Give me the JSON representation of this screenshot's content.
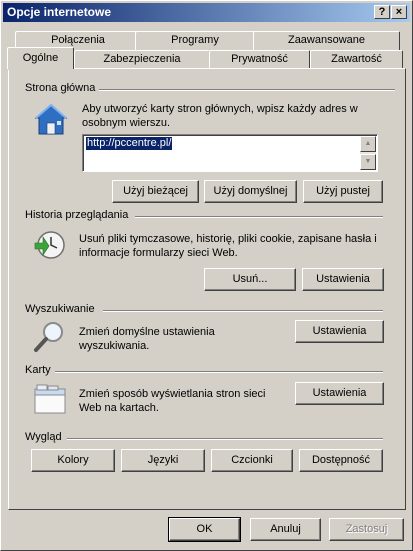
{
  "window": {
    "title": "Opcje internetowe",
    "help_label": "?",
    "close_label": "×"
  },
  "tabs": {
    "row_top": [
      "Połączenia",
      "Programy",
      "Zaawansowane"
    ],
    "row_bottom": [
      "Ogólne",
      "Zabezpieczenia",
      "Prywatność",
      "Zawartość"
    ],
    "active": "Ogólne"
  },
  "home": {
    "label": "Strona główna",
    "description": "Aby utworzyć karty stron głównych, wpisz każdy adres w osobnym wierszu.",
    "url_value": "http://pccentre.pl/",
    "btn_current": "Użyj bieżącej",
    "btn_default": "Użyj domyślnej",
    "btn_blank": "Użyj pustej"
  },
  "history": {
    "label": "Historia przeglądania",
    "description": "Usuń pliki tymczasowe, historię, pliki cookie, zapisane hasła i informacje formularzy sieci Web.",
    "btn_delete": "Usuń...",
    "btn_settings": "Ustawienia"
  },
  "search": {
    "label": "Wyszukiwanie",
    "description": "Zmień domyślne ustawienia wyszukiwania.",
    "btn_settings": "Ustawienia"
  },
  "tabs_section": {
    "label": "Karty",
    "description": "Zmień sposób wyświetlania stron sieci Web na kartach.",
    "btn_settings": "Ustawienia"
  },
  "appearance": {
    "label": "Wygląd",
    "btn_colors": "Kolory",
    "btn_languages": "Języki",
    "btn_fonts": "Czcionki",
    "btn_accessibility": "Dostępność"
  },
  "footer": {
    "ok": "OK",
    "cancel": "Anuluj",
    "apply": "Zastosuj"
  }
}
